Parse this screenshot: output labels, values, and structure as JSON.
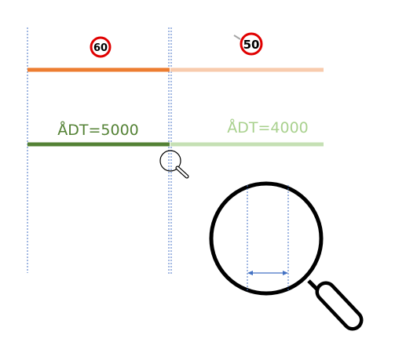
{
  "speed_signs": {
    "left": {
      "value": "60"
    },
    "right": {
      "value": "50"
    }
  },
  "traffic_labels": {
    "left": "ÅDT=5000",
    "right": "ÅDT=4000"
  },
  "colors": {
    "speed_line_left": "#ED7D31",
    "speed_line_right": "#F8CBAD",
    "traffic_line_left": "#548235",
    "traffic_line_right": "#C5E0B4",
    "traffic_text_left": "#548235",
    "traffic_text_right": "#A9D18E",
    "boundary_line": "#4472C4",
    "sign_ring": "#E00000",
    "magnifier": "#000000",
    "arrow": "#4472C4"
  },
  "icons": {
    "small_magnifier": "magnifier-icon",
    "large_magnifier": "magnifier-icon",
    "gap_arrow": "double-arrow-icon"
  }
}
